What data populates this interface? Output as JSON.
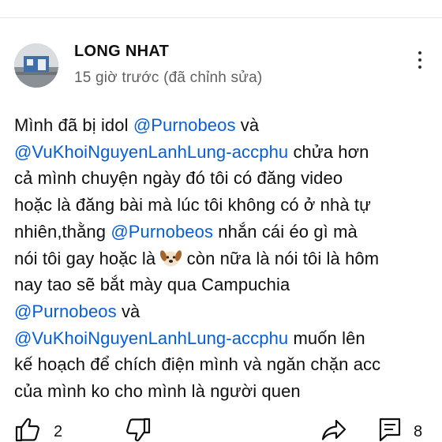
{
  "comment": {
    "author": "LONG NHAT",
    "meta": "15 giờ trước (đã chỉnh sửa)",
    "lines": [
      [
        {
          "t": "Mình đã bị idol "
        },
        {
          "t": "@Purnobeos",
          "m": true
        },
        {
          "t": " và"
        }
      ],
      [
        {
          "t": "@VuKhoiNguyenLanhLung-accphu",
          "m": true
        },
        {
          "t": " chửa hơn"
        }
      ],
      [
        {
          "t": "cả mình chuyện ngày đó tôi có đăng video"
        }
      ],
      [
        {
          "t": "hoặc là đăng bài mà lúc tôi không có ở nhà  tự"
        }
      ],
      [
        {
          "t": "nhiên,thằng "
        },
        {
          "t": "@Purnobeos",
          "m": true
        },
        {
          "t": " nhắn cái éo gì mà"
        }
      ],
      [
        {
          "t": "nói tôi gay hoặc là "
        },
        {
          "e": "dog-face-emoji"
        },
        {
          "t": " còn nữa là nói tôi là hôm"
        }
      ],
      [
        {
          "t": "nay tao sẽ bắt mày qua Campuchia"
        }
      ],
      [
        {
          "t": "@Purnobeos",
          "m": true
        },
        {
          "t": " và"
        }
      ],
      [
        {
          "t": "@VuKhoiNguyenLanhLung-accphu",
          "m": true
        },
        {
          "t": " muốn lên"
        }
      ],
      [
        {
          "t": "kế hoạch để chích điện mình và ngăn chặn acc"
        }
      ],
      [
        {
          "t": "của mình ko cho mình là người quen"
        }
      ]
    ]
  },
  "actions": {
    "like_icon": "thumbs-up-icon",
    "like_count": "2",
    "dislike_icon": "thumbs-down-icon",
    "share_icon": "share-icon",
    "reply_icon": "comment-icon",
    "reply_count": "8"
  },
  "colors": {
    "mention": "#065fd4",
    "text": "#0f0f0f",
    "meta": "#606060"
  }
}
